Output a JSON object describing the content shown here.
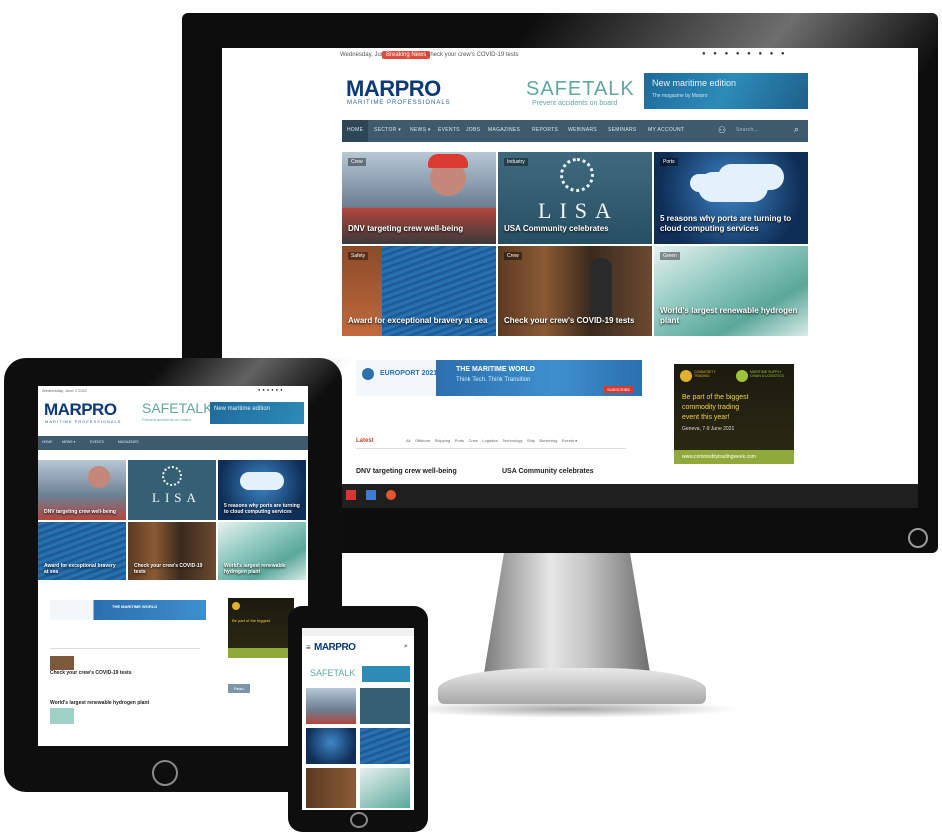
{
  "topbar": {
    "date": "Wednesday, June 2 2021",
    "breaking_label": "Breaking News",
    "ticker": "Check your crew's COVID-19 tests",
    "social_icons": [
      "facebook-icon",
      "twitter-icon",
      "youtube-icon",
      "linkedin-icon",
      "rss-icon",
      "instagram-icon",
      "mail-icon",
      "shop-icon"
    ]
  },
  "brand": {
    "logo": "MARPRO",
    "tagline": "MARITIME PROFESSIONALS",
    "ad_title": "SAFETALK",
    "ad_sub": "Prevent accidents on board",
    "ad_edition": "New maritime edition",
    "ad_edition_sub": "The magazine by Marpro"
  },
  "nav": {
    "items": [
      "HOME",
      "SECTOR ▾",
      "NEWS ▾",
      "EVENTS",
      "JOBS",
      "MAGAZINES",
      "REPORTS",
      "WEBINARS",
      "SEMINARS",
      "MY ACCOUNT"
    ],
    "search_placeholder": "Search..."
  },
  "tiles": [
    {
      "tag": "Crew",
      "caption": "DNV targeting crew well-being"
    },
    {
      "tag": "Industry",
      "caption": "USA Community celebrates"
    },
    {
      "tag": "Ports",
      "caption": "5 reasons why ports are turning to cloud computing services"
    },
    {
      "tag": "Safety",
      "caption": "Award for exceptional bravery at sea"
    },
    {
      "tag": "Crew",
      "caption": "Check your crew's COVID-19 tests"
    },
    {
      "tag": "Green",
      "caption": "World's largest renewable hydrogen plant"
    }
  ],
  "lisa_text": "LISA",
  "banner_main": {
    "left": "EUROPORT 2021",
    "title": "THE MARITIME WORLD",
    "sub": "Think Tech. Think Transition",
    "cta": "SUBSCRIBE"
  },
  "banner_side": {
    "badge1": "COMMODITY TRADING",
    "badge2": "MARITIME SUPPLY CHAIN & LOGISTICS",
    "line1": "Be part of the biggest",
    "line2": "commodity trading",
    "line3": "event this year!",
    "line4": "Geneva, 7-9 June 2021",
    "url": "www.commoditytradingweek.com"
  },
  "latest": {
    "label": "Latest",
    "filters": [
      "All",
      "Offshore",
      "Shipping",
      "Ports",
      "Crew",
      "Logistics",
      "Technology",
      "Ship",
      "Bunkering",
      "Events ▾"
    ],
    "items": [
      "DNV targeting crew well-being",
      "USA Community celebrates"
    ]
  },
  "tablet_list": {
    "items": [
      "Check your crew's COVID-19 tests",
      "World's largest renewable hydrogen plant"
    ],
    "button": "Read"
  }
}
